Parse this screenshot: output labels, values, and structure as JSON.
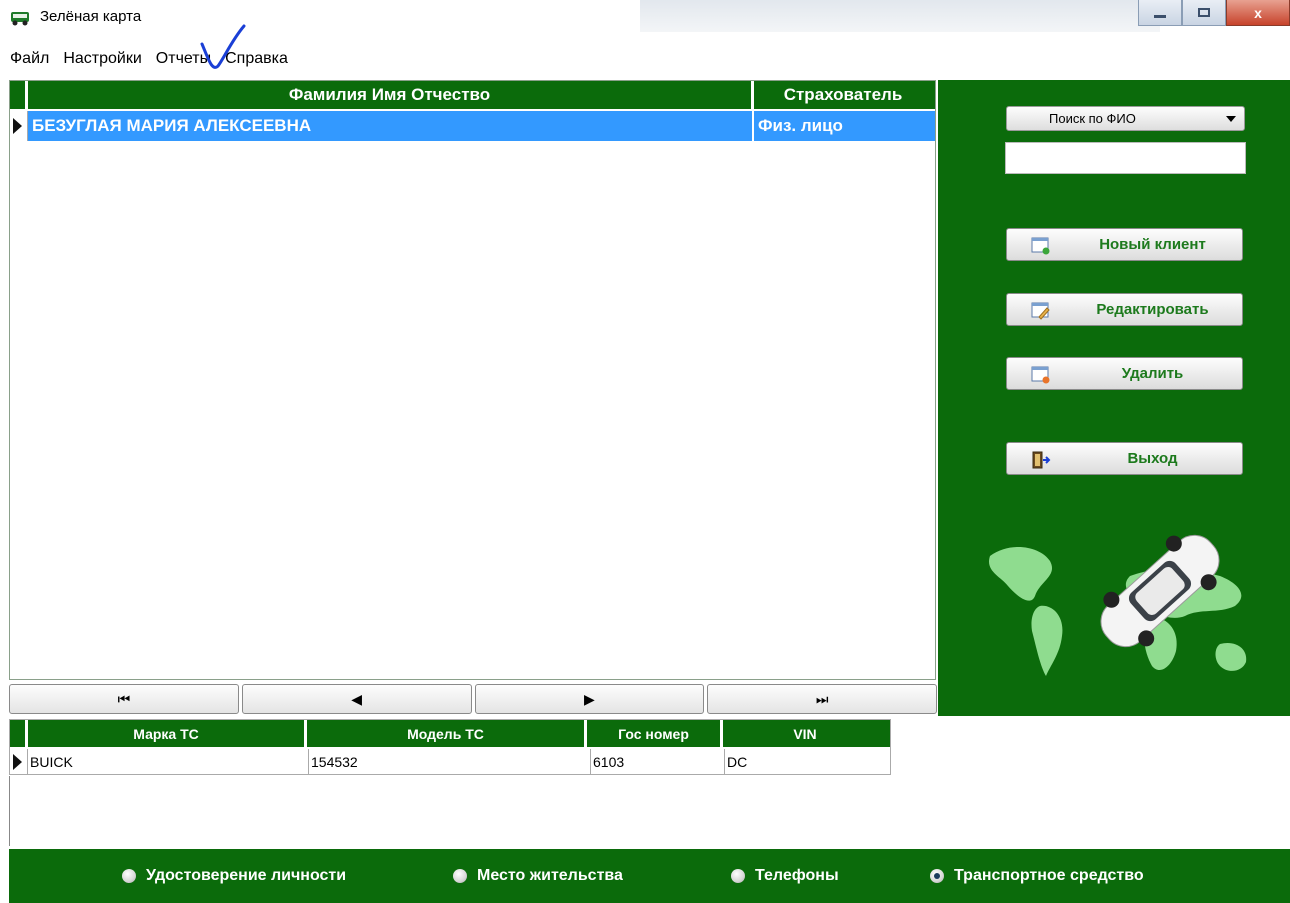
{
  "window": {
    "title": "Зелёная карта"
  },
  "menu": {
    "items": [
      "Файл",
      "Настройки",
      "Отчеты",
      "Справка"
    ]
  },
  "clients_grid": {
    "columns": [
      "Фамилия Имя Отчество",
      "Страхователь"
    ],
    "rows": [
      {
        "fio": "БЕЗУГЛАЯ МАРИЯ АЛЕКСЕЕВНА",
        "insurer": "Физ. лицо",
        "selected": true
      }
    ]
  },
  "navigation": {
    "first": "⏮",
    "prev": "◀",
    "next": "▶",
    "last": "⏭"
  },
  "side_panel": {
    "search_mode": "Поиск по ФИО",
    "search_value": "",
    "buttons": {
      "new_client": "Новый клиент",
      "edit": "Редактировать",
      "delete": "Удалить",
      "exit": "Выход"
    }
  },
  "vehicle_grid": {
    "columns": [
      "Марка ТС",
      "Модель ТС",
      "Гос номер",
      "VIN"
    ],
    "rows": [
      {
        "make": "BUICK",
        "model": "154532",
        "plate": "6103",
        "vin": "DC"
      }
    ]
  },
  "tabs": {
    "options": [
      "Удостоверение личности",
      "Место жительства",
      "Телефоны",
      "Транспортное средство"
    ],
    "selected": "Транспортное средство"
  },
  "colors": {
    "accent_green": "#0b6b0b",
    "selection_blue": "#3399ff",
    "button_text_green": "#1d7a1d"
  }
}
